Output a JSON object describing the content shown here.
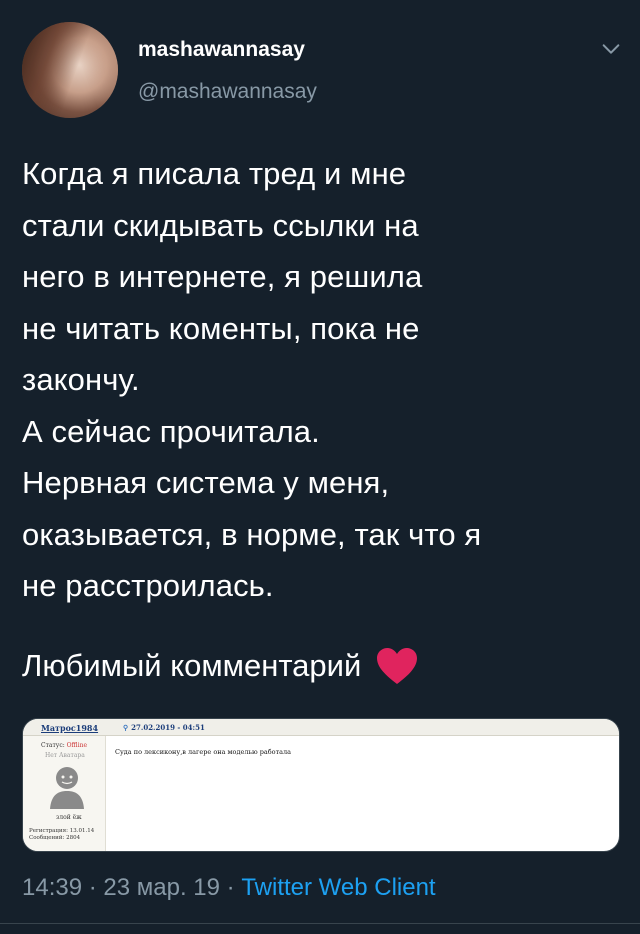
{
  "tweet": {
    "display_name": "mashawannasay",
    "handle": "@mashawannasay",
    "text": "Когда я писала тред и мне\nстали скидывать ссылки на\nнего в интернете, я решила\nне читать коменты, пока не\nзакончу.\nА сейчас прочитала.\nНервная система у меня,\nоказывается, в норме, так что я\nне расстроилась.",
    "favorite_line": "Любимый комментарий",
    "heart_icon": "heart-icon",
    "heart_color": "#e0245e",
    "time": "14:39",
    "date": "23 мар. 19",
    "separator": " · ",
    "client": "Twitter Web Client"
  },
  "embedded_forum": {
    "author": "Матрос1984",
    "date": "27.02.2019 - 04:51",
    "status_label": "Статус: ",
    "status_value": "Offline",
    "no_avatar": "Нет Аватара",
    "nickname": "злой ёж",
    "registration": "Регистрация: 13.01.14",
    "messages": "Сообщений: 2804",
    "message_text": "Суда по лексикону,в лагере она моделью работала"
  },
  "colors": {
    "background": "#15202b",
    "secondary_text": "#8899a6",
    "link": "#1da1f2",
    "divider": "#38444d"
  }
}
